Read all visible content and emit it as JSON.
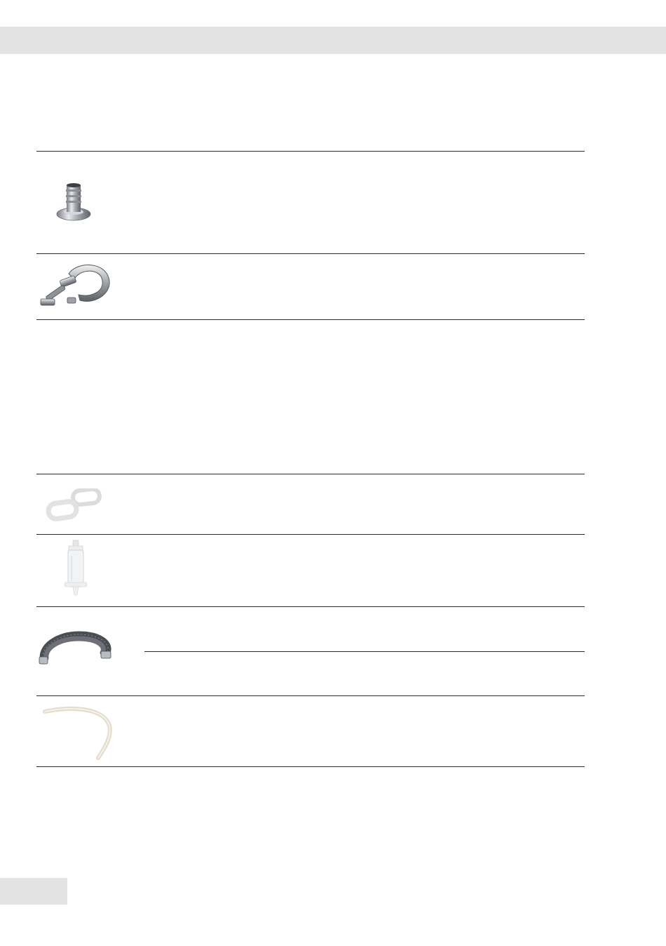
{
  "page": {
    "header_band_color": "#e3e3e3",
    "rule_color": "#2a2a2a"
  },
  "table_1": {
    "rows": [
      {
        "image": "hose-connector-icon"
      },
      {
        "image": "clamp-icon"
      }
    ]
  },
  "table_2": {
    "rows": [
      {
        "image": "gasket-rings-icon"
      },
      {
        "image": "syringe-icon"
      },
      {
        "image": "hose-icon"
      },
      {
        "image": "tubing-icon"
      }
    ]
  }
}
